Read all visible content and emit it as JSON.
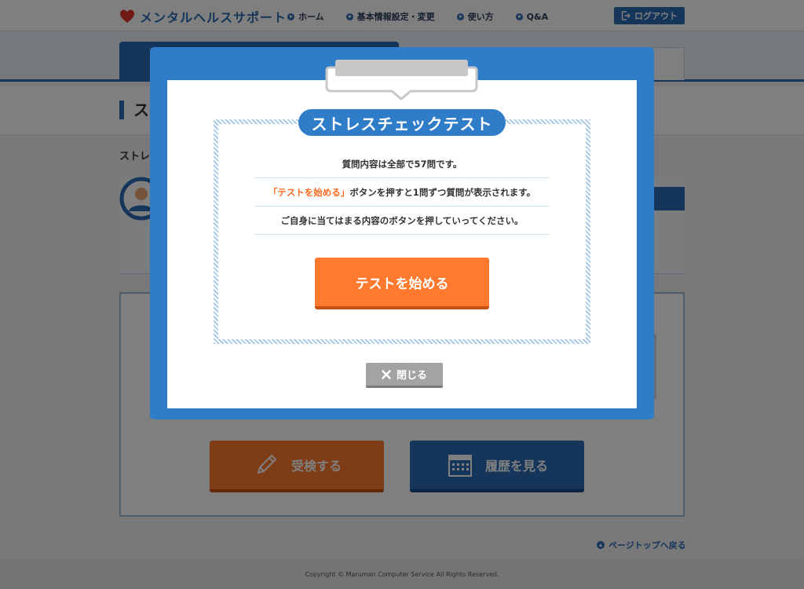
{
  "header": {
    "logo_text": "メンタルヘルスサポート",
    "nav": [
      "ホーム",
      "基本情報設定・変更",
      "使い方",
      "Q&A"
    ],
    "logout_label": "ログアウト"
  },
  "page": {
    "title": "ス",
    "intro_text": "ストレ"
  },
  "actions": {
    "exam_label": "受検する",
    "history_label": "履歴を見る"
  },
  "pagetop_label": "ページトップへ戻る",
  "footer_text": "Copyright ©   Maruman Computer Service All Rights Reserved.",
  "modal": {
    "title": "ストレスチェックテスト",
    "line1": "質問内容は全部で57問です。",
    "line2_highlight": "「テストを始める」",
    "line2_rest": "ボタンを押すと1問ずつ質問が表示されます。",
    "line3": "ご自身に当てはまる内容のボタンを押していってください。",
    "start_label": "テストを始める",
    "close_label": "閉じる"
  },
  "colors": {
    "brand_blue": "#2f7cc9",
    "accent_orange": "#ff7a2e",
    "heart_red": "#e0342b",
    "close_gray": "#a3a3a3"
  },
  "icons": [
    "heart-icon",
    "nav-bullet-icon",
    "logout-icon",
    "avatar-icon",
    "pencil-icon",
    "calendar-icon",
    "arrow-up-icon",
    "close-x-icon"
  ]
}
